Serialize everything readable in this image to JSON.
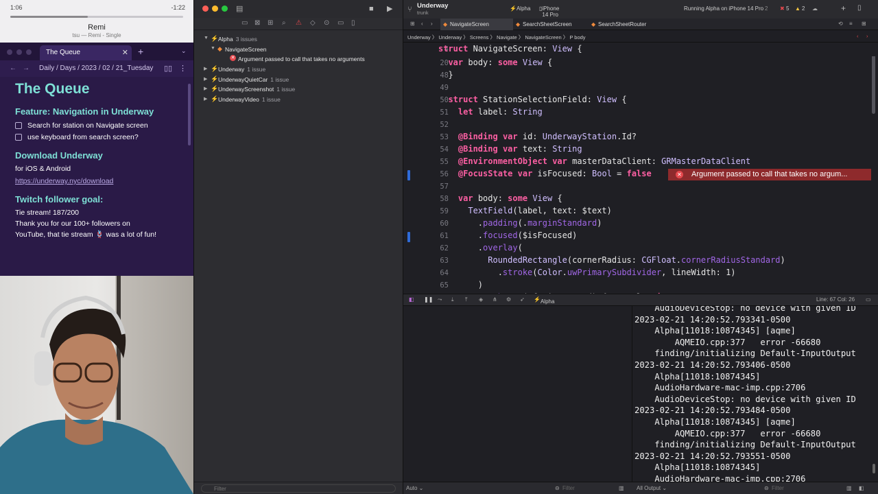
{
  "music": {
    "elapsed": "1:06",
    "remaining": "-1:22",
    "progress": 0.45,
    "title": "Remi",
    "subtitle": "tsu — Remi - Single"
  },
  "obsidian": {
    "tab_title": "The Queue",
    "breadcrumb": "Daily / Days / 2023 / 02 / 21_Tuesday",
    "heading": "The Queue",
    "feature_heading": "Feature: Navigation in Underway",
    "tasks": [
      "Search for station on Navigate screen",
      "use keyboard from search screen?"
    ],
    "download_heading": "Download Underway",
    "download_sub": "for iOS & Android",
    "download_link": "https://underway.nyc/download",
    "twitch_heading": "Twitch follower goal:",
    "twitch_lines": [
      "Tie stream!  187/200",
      "Thank you for our 100+ followers on",
      "YouTube, that tie stream 🪢 was a lot of fun!"
    ]
  },
  "navigator": {
    "filter_placeholder": "Filter",
    "issues": [
      {
        "name": "Alpha",
        "count": "3 issues",
        "level": 0,
        "expanded": true
      },
      {
        "name": "NavigateScreen",
        "count": "",
        "level": 1,
        "expanded": true,
        "kind": "file"
      },
      {
        "name": "Argument passed to call that takes no arguments",
        "count": "",
        "level": 2,
        "kind": "error"
      },
      {
        "name": "Underway",
        "count": "1 issue",
        "level": 0,
        "expanded": false
      },
      {
        "name": "UnderwayQuietCar",
        "count": "1 issue",
        "level": 0,
        "expanded": false
      },
      {
        "name": "UnderwayScreenshot",
        "count": "1 issue",
        "level": 0,
        "expanded": false
      },
      {
        "name": "UnderwayVideo",
        "count": "1 issue",
        "level": 0,
        "expanded": false
      }
    ]
  },
  "editor": {
    "project": "Underway",
    "branch": "trunk",
    "scheme": "Alpha",
    "device": "iPhone 14 Pro",
    "status": "Running Alpha on iPhone 14 Pro",
    "status_count": "2",
    "error_count": "5",
    "warning_count": "2",
    "tabs": [
      "NavigateScreen",
      "SearchSheetScreen",
      "SearchSheetRouter"
    ],
    "jumpbar": "Underway 〉 Underway 〉 Screens 〉 Navigate 〉 NavigateScreen 〉 P body",
    "sticky_line": {
      "n": "4",
      "text": "struct NavigateScreen: View {"
    },
    "error_message": "Argument passed to call that takes no argum...",
    "cursor": "Line: 67  Col: 26",
    "debug_target": "Alpha",
    "output_mode": "Auto ⌄",
    "output_filter": "All Output ⌄",
    "filter_placeholder": "Filter",
    "code_lines": [
      {
        "n": "20",
        "text": "  var body: some View {"
      },
      {
        "n": "48",
        "text": "  }"
      },
      {
        "n": "49",
        "text": ""
      },
      {
        "n": "50",
        "text": "  struct StationSelectionField: View {"
      },
      {
        "n": "51",
        "text": "    let label: String"
      },
      {
        "n": "52",
        "text": ""
      },
      {
        "n": "53",
        "text": "    @Binding var id: UnderwayStation.Id?"
      },
      {
        "n": "54",
        "text": "    @Binding var text: String"
      },
      {
        "n": "55",
        "text": "    @EnvironmentObject var masterDataClient: GRMasterDataClient"
      },
      {
        "n": "56",
        "text": "    @FocusState var isFocused: Bool = false"
      },
      {
        "n": "57",
        "text": ""
      },
      {
        "n": "58",
        "text": "    var body: some View {"
      },
      {
        "n": "59",
        "text": "      TextField(label, text: $text)"
      },
      {
        "n": "60",
        "text": "        .padding(.marginStandard)"
      },
      {
        "n": "61",
        "text": "        .focused($isFocused)"
      },
      {
        "n": "62",
        "text": "        .overlay("
      },
      {
        "n": "63",
        "text": "          RoundedRectangle(cornerRadius: CGFloat.cornerRadiusStandard)"
      },
      {
        "n": "64",
        "text": "            .stroke(Color.uwPrimarySubdivider, lineWidth: 1)"
      },
      {
        "n": "65",
        "text": "        )"
      },
      {
        "n": "66",
        "text": "        .onChange(of: isFocused) { newValue in"
      }
    ],
    "console_lines": [
      "    AudioDeviceStop: no device with given ID",
      "2023-02-21 14:20:52.793341-0500",
      "    Alpha[11018:10874345] [aqme]",
      "        AQMEIO.cpp:377   error -66680",
      "    finding/initializing Default-InputOutput",
      "2023-02-21 14:20:52.793406-0500",
      "    Alpha[11018:10874345]",
      "    AudioHardware-mac-imp.cpp:2706",
      "    AudioDeviceStop: no device with given ID",
      "2023-02-21 14:20:52.793484-0500",
      "    Alpha[11018:10874345] [aqme]",
      "        AQMEIO.cpp:377   error -66680",
      "    finding/initializing Default-InputOutput",
      "2023-02-21 14:20:52.793551-0500",
      "    Alpha[11018:10874345]",
      "    AudioHardware-mac-imp.cpp:2706"
    ]
  },
  "colors": {
    "obsidian_bg": "#2a1a47",
    "heading_teal": "#7ee0d6",
    "xcode_bg": "#1f1f24",
    "keyword_pink": "#fc5fa3",
    "error_red": "#8e2a2c"
  }
}
